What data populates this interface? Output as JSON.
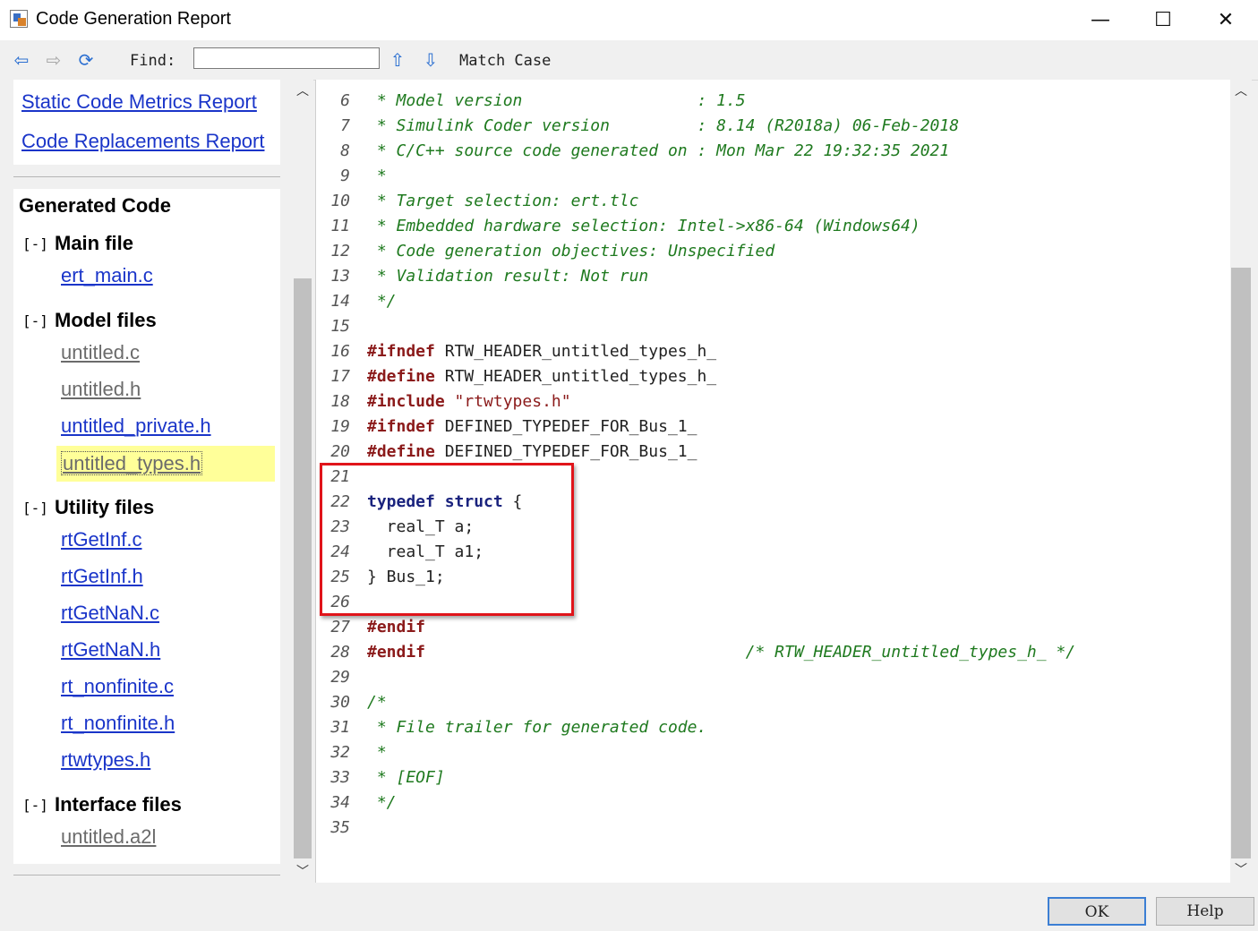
{
  "window": {
    "title": "Code Generation Report",
    "minimize_label": "—",
    "maximize_label": "☐",
    "close_label": "✕"
  },
  "toolbar": {
    "back_icon": "⇦",
    "forward_icon": "⇨",
    "refresh_icon": "⟳",
    "find_label": "Find:",
    "find_value": "",
    "up_icon": "⇧",
    "down_icon": "⇩",
    "match_case_label": "Match Case"
  },
  "reports": {
    "static_metrics": "Static Code Metrics Report",
    "code_replacements": "Code Replacements Report"
  },
  "generated_code": {
    "title": "Generated Code",
    "groups": [
      {
        "toggle": "[-]",
        "label": "Main file",
        "files": [
          "ert_main.c"
        ]
      },
      {
        "toggle": "[-]",
        "label": "Model files",
        "files": [
          "untitled.c",
          "untitled.h",
          "untitled_private.h",
          "untitled_types.h"
        ]
      },
      {
        "toggle": "[-]",
        "label": "Utility files",
        "files": [
          "rtGetInf.c",
          "rtGetInf.h",
          "rtGetNaN.c",
          "rtGetNaN.h",
          "rt_nonfinite.c",
          "rt_nonfinite.h",
          "rtwtypes.h"
        ]
      },
      {
        "toggle": "[-]",
        "label": "Interface files",
        "files": [
          "untitled.a2l"
        ]
      }
    ]
  },
  "code": {
    "lines": [
      {
        "n": "6",
        "segs": [
          {
            "c": "cm",
            "t": " * Model version                  : 1.5"
          }
        ]
      },
      {
        "n": "7",
        "segs": [
          {
            "c": "cm",
            "t": " * Simulink Coder version         : 8.14 (R2018a) 06-Feb-2018"
          }
        ]
      },
      {
        "n": "8",
        "segs": [
          {
            "c": "cm",
            "t": " * C/C++ source code generated on : Mon Mar 22 19:32:35 2021"
          }
        ]
      },
      {
        "n": "9",
        "segs": [
          {
            "c": "cm",
            "t": " *"
          }
        ]
      },
      {
        "n": "10",
        "segs": [
          {
            "c": "cm",
            "t": " * Target selection: ert.tlc"
          }
        ]
      },
      {
        "n": "11",
        "segs": [
          {
            "c": "cm",
            "t": " * Embedded hardware selection: Intel->x86-64 (Windows64)"
          }
        ]
      },
      {
        "n": "12",
        "segs": [
          {
            "c": "cm",
            "t": " * Code generation objectives: Unspecified"
          }
        ]
      },
      {
        "n": "13",
        "segs": [
          {
            "c": "cm",
            "t": " * Validation result: Not run"
          }
        ]
      },
      {
        "n": "14",
        "segs": [
          {
            "c": "cm",
            "t": " */"
          }
        ]
      },
      {
        "n": "15",
        "segs": []
      },
      {
        "n": "16",
        "segs": [
          {
            "c": "pp",
            "t": "#ifndef"
          },
          {
            "c": "pl",
            "t": " RTW_HEADER_untitled_types_h_"
          }
        ]
      },
      {
        "n": "17",
        "segs": [
          {
            "c": "pp",
            "t": "#define"
          },
          {
            "c": "pl",
            "t": " RTW_HEADER_untitled_types_h_"
          }
        ]
      },
      {
        "n": "18",
        "segs": [
          {
            "c": "pp",
            "t": "#include"
          },
          {
            "c": "st",
            "t": " \"rtwtypes.h\""
          }
        ]
      },
      {
        "n": "19",
        "segs": [
          {
            "c": "pp",
            "t": "#ifndef"
          },
          {
            "c": "pl",
            "t": " DEFINED_TYPEDEF_FOR_Bus_1_"
          }
        ]
      },
      {
        "n": "20",
        "segs": [
          {
            "c": "pp",
            "t": "#define"
          },
          {
            "c": "pl",
            "t": " DEFINED_TYPEDEF_FOR_Bus_1_"
          }
        ]
      },
      {
        "n": "21",
        "segs": []
      },
      {
        "n": "22",
        "segs": [
          {
            "c": "kw",
            "t": "typedef struct"
          },
          {
            "c": "pl",
            "t": " {"
          }
        ]
      },
      {
        "n": "23",
        "segs": [
          {
            "c": "pl",
            "t": "  real_T a;"
          }
        ]
      },
      {
        "n": "24",
        "segs": [
          {
            "c": "pl",
            "t": "  real_T a1;"
          }
        ]
      },
      {
        "n": "25",
        "segs": [
          {
            "c": "pl",
            "t": "} Bus_1;"
          }
        ]
      },
      {
        "n": "26",
        "segs": []
      },
      {
        "n": "27",
        "segs": [
          {
            "c": "pp",
            "t": "#endif"
          }
        ]
      },
      {
        "n": "28",
        "segs": [
          {
            "c": "pp",
            "t": "#endif"
          },
          {
            "c": "pl",
            "t": "                                 "
          },
          {
            "c": "cm",
            "t": "/* RTW_HEADER_untitled_types_h_ */"
          }
        ]
      },
      {
        "n": "29",
        "segs": []
      },
      {
        "n": "30",
        "segs": [
          {
            "c": "cm",
            "t": "/*"
          }
        ]
      },
      {
        "n": "31",
        "segs": [
          {
            "c": "cm",
            "t": " * File trailer for generated code."
          }
        ]
      },
      {
        "n": "32",
        "segs": [
          {
            "c": "cm",
            "t": " *"
          }
        ]
      },
      {
        "n": "33",
        "segs": [
          {
            "c": "cm",
            "t": " * [EOF]"
          }
        ]
      },
      {
        "n": "34",
        "segs": [
          {
            "c": "cm",
            "t": " */"
          }
        ]
      },
      {
        "n": "35",
        "segs": []
      }
    ]
  },
  "buttons": {
    "ok": "OK",
    "help": "Help"
  },
  "colors": {
    "link": "#1a35c9",
    "comment": "#1f7a1f",
    "preprocessor": "#8b1a1a",
    "keyword": "#1a237e",
    "selection_highlight": "#ffff99",
    "annotation_box": "#e0141a"
  },
  "icons": {
    "app": "app-icon",
    "back": "back-arrow-icon",
    "forward": "forward-arrow-icon",
    "refresh": "refresh-icon",
    "find_up": "find-previous-icon",
    "find_down": "find-next-icon",
    "scroll_up": "scroll-up-icon",
    "scroll_down": "scroll-down-icon"
  }
}
